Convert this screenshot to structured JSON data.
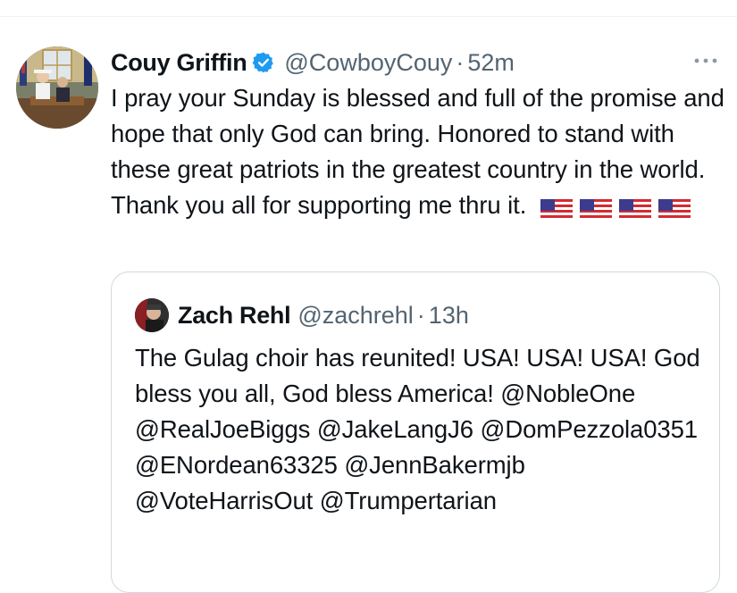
{
  "tweet": {
    "author_name": "Couy Griffin",
    "handle": "@CowboyCouy",
    "separator": "·",
    "time": "52m",
    "text": "I pray your Sunday is blessed and full of the promise and hope that only God can bring. Honored to stand with these great patriots in the greatest country in the world. Thank you all for supporting me thru it.",
    "flags": [
      "us-flag-icon",
      "us-flag-icon",
      "us-flag-icon",
      "us-flag-icon"
    ],
    "verified_icon": "verified-badge-icon",
    "more_icon": "more-options-icon"
  },
  "quote": {
    "author_name": "Zach Rehl",
    "handle": "@zachrehl",
    "separator": "·",
    "time": "13h",
    "text": "The Gulag choir has reunited! USA! USA! USA! God bless you all, God bless America! @NobleOne @RealJoeBiggs @JakeLangJ6 @DomPezzola0351 @ENordean63325 @JennBakermjb @VoteHarrisOut @Trumpertarian"
  },
  "colors": {
    "text": "#0f1419",
    "secondary": "#536471",
    "verified_blue": "#1d9bf0",
    "border": "#cfd9de"
  }
}
